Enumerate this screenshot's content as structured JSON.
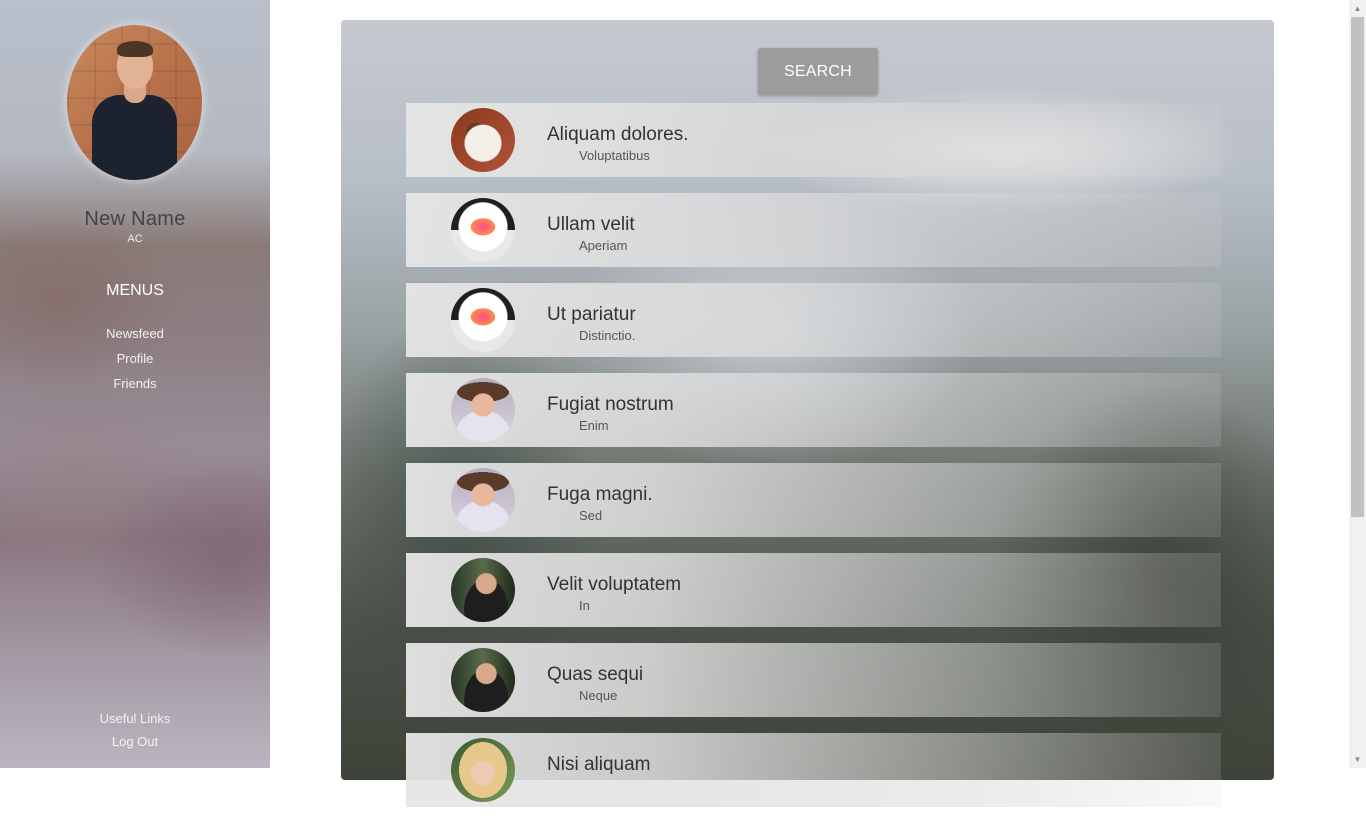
{
  "sidebar": {
    "profile": {
      "name": "New Name",
      "subtitle": "AC"
    },
    "menus_title": "MENUS",
    "nav_items": [
      {
        "label": "Newsfeed"
      },
      {
        "label": "Profile"
      },
      {
        "label": "Friends"
      }
    ],
    "bottom_links": [
      {
        "label": "Useful Links"
      },
      {
        "label": "Log Out"
      }
    ]
  },
  "main": {
    "search_button_label": "SEARCH",
    "list": [
      {
        "title": "Aliquam dolores.",
        "subtitle": "Voluptatibus",
        "avatar": "dog-avatar"
      },
      {
        "title": "Ullam velit",
        "subtitle": "Aperiam",
        "avatar": "astronaut-avatar"
      },
      {
        "title": "Ut pariatur",
        "subtitle": "Distinctio.",
        "avatar": "astronaut-avatar"
      },
      {
        "title": "Fugiat nostrum",
        "subtitle": "Enim",
        "avatar": "woman-hat-avatar"
      },
      {
        "title": "Fuga magni.",
        "subtitle": "Sed",
        "avatar": "woman-hat-avatar"
      },
      {
        "title": "Velit voluptatem",
        "subtitle": "In",
        "avatar": "man-avatar"
      },
      {
        "title": "Quas sequi",
        "subtitle": "Neque",
        "avatar": "man-avatar"
      },
      {
        "title": "Nisi aliquam",
        "subtitle": "",
        "avatar": "blonde-woman-avatar"
      }
    ]
  },
  "scrollbar": {
    "up_icon": "scroll-up-arrow-icon",
    "down_icon": "scroll-down-arrow-icon"
  }
}
